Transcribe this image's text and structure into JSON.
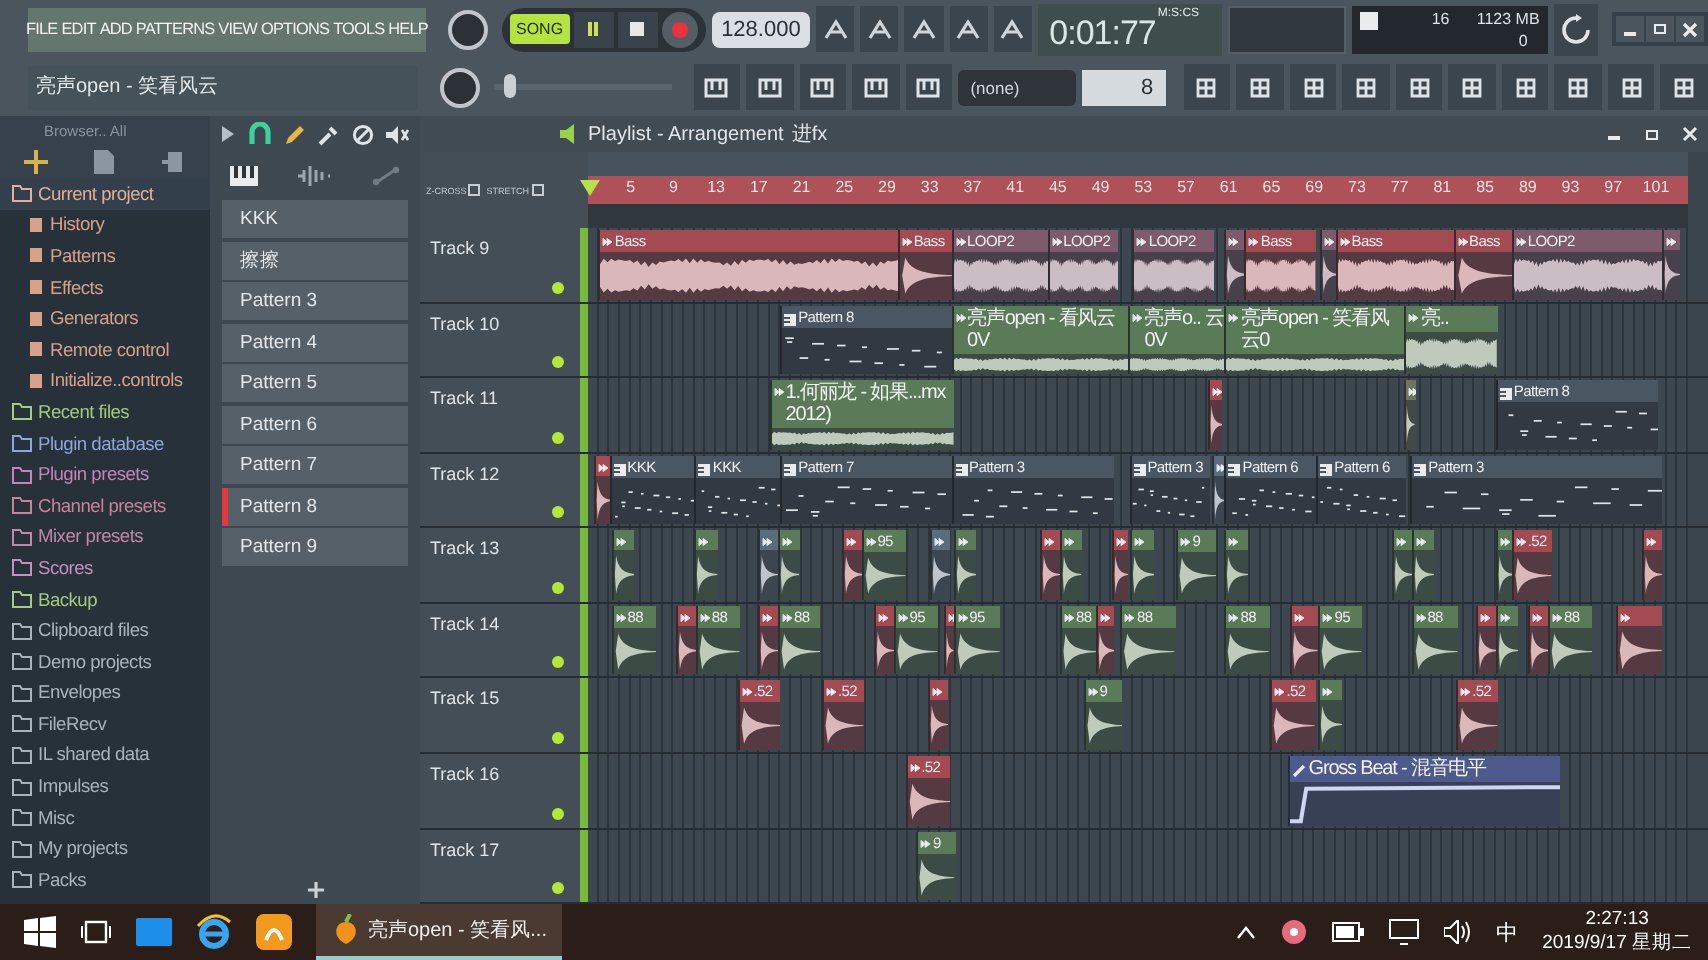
{
  "menu": [
    "FILE",
    "EDIT",
    "ADD",
    "PATTERNS",
    "VIEW",
    "OPTIONS",
    "TOOLS",
    "HELP"
  ],
  "hint_bar": {
    "text": "亮声open - 笑看风云"
  },
  "pitch_slider": {
    "level": 0.05
  },
  "transport": {
    "mode_label": "SONG",
    "song_selected": true,
    "tempo": "128.000",
    "time": "0:01:77",
    "time_unit": "M:S:CS"
  },
  "status": {
    "polyphony": "16",
    "memory": "1123 MB",
    "cpu": "0"
  },
  "toolbar": {
    "preset": "(none)",
    "snap": "8"
  },
  "browser": {
    "title": "Browser.. All",
    "items": [
      {
        "label": "Current project",
        "color": "#e0b09a",
        "selected": true,
        "children": [
          {
            "label": "History",
            "color": "#d9a08a",
            "selected": false
          },
          {
            "label": "Patterns",
            "color": "#d9a08a",
            "selected": false
          },
          {
            "label": "Effects",
            "color": "#d9a08a",
            "selected": false
          },
          {
            "label": "Generators",
            "color": "#d9a08a",
            "selected": false
          },
          {
            "label": "Remote control",
            "color": "#d9a08a",
            "selected": false
          },
          {
            "label": "Initialize..controls",
            "color": "#d9a08a",
            "selected": false
          }
        ]
      },
      {
        "label": "Recent files",
        "color": "#a9c97c",
        "selected": false
      },
      {
        "label": "Plugin database",
        "color": "#8ea6dc",
        "selected": false
      },
      {
        "label": "Plugin presets",
        "color": "#c883b8",
        "selected": false
      },
      {
        "label": "Channel presets",
        "color": "#c8829e",
        "selected": false
      },
      {
        "label": "Mixer presets",
        "color": "#c487ab",
        "selected": false
      },
      {
        "label": "Scores",
        "color": "#c88fbb",
        "selected": false
      },
      {
        "label": "Backup",
        "color": "#a9c97c",
        "selected": false
      },
      {
        "label": "Clipboard files",
        "color": "#a9b3bc",
        "selected": false
      },
      {
        "label": "Demo projects",
        "color": "#a9b3bc",
        "selected": false
      },
      {
        "label": "Envelopes",
        "color": "#a9b3bc",
        "selected": false
      },
      {
        "label": "FileRecv",
        "color": "#a9b3bc",
        "selected": false
      },
      {
        "label": "IL shared data",
        "color": "#a9b3bc",
        "selected": false
      },
      {
        "label": "Impulses",
        "color": "#a9b3bc",
        "selected": false
      },
      {
        "label": "Misc",
        "color": "#a9b3bc",
        "selected": false
      },
      {
        "label": "My projects",
        "color": "#a9b3bc",
        "selected": false
      },
      {
        "label": "Packs",
        "color": "#a9b3bc",
        "selected": false
      }
    ]
  },
  "patterns": [
    {
      "label": "KKK",
      "selected": false
    },
    {
      "label": "擦擦",
      "selected": false
    },
    {
      "label": "Pattern 3",
      "selected": false
    },
    {
      "label": "Pattern 4",
      "selected": false
    },
    {
      "label": "Pattern 5",
      "selected": false
    },
    {
      "label": "Pattern 6",
      "selected": false
    },
    {
      "label": "Pattern 7",
      "selected": false
    },
    {
      "label": "Pattern 8",
      "selected": true
    },
    {
      "label": "Pattern 9",
      "selected": false
    }
  ],
  "playlist": {
    "title": "Playlist - Arrangement",
    "breadcrumb": "进fx",
    "z_cross": {
      "label": "Z-CROSS",
      "checked": false
    },
    "stretch": {
      "label": "STRETCH",
      "checked": false
    },
    "ruler": [
      "5",
      "9",
      "13",
      "17",
      "21",
      "25",
      "29",
      "33",
      "37",
      "41",
      "45",
      "49",
      "53",
      "57",
      "61",
      "65",
      "69",
      "73",
      "77",
      "81",
      "85",
      "89",
      "93",
      "97",
      "101"
    ],
    "tracks": [
      {
        "name": "Track 9",
        "enabled": true,
        "clips": [
          {
            "label": "Bass",
            "kind": "audio",
            "color": "#a34a53"
          },
          {
            "label": "Bass",
            "kind": "audio",
            "color": "#a34a53"
          },
          {
            "label": "LOOP2",
            "kind": "audio",
            "color": "#7e5a6d"
          },
          {
            "label": "LOOP2",
            "kind": "audio",
            "color": "#7e5a6d"
          },
          {
            "label": "LOOP2",
            "kind": "audio",
            "color": "#7e5a6d"
          },
          {
            "kind": "audio",
            "color": "#7e5a6d"
          },
          {
            "label": "Bass",
            "kind": "audio",
            "color": "#a34a53"
          },
          {
            "kind": "audio",
            "color": "#7e5a6d"
          },
          {
            "label": "Bass",
            "kind": "audio",
            "color": "#a34a53"
          },
          {
            "label": "Bass",
            "kind": "audio",
            "color": "#a34a53"
          },
          {
            "label": "LOOP2",
            "kind": "audio",
            "color": "#7e5a6d"
          },
          {
            "kind": "audio",
            "color": "#7e5a6d"
          }
        ]
      },
      {
        "name": "Track 10",
        "enabled": true,
        "clips": [
          {
            "label": "Pattern 8",
            "kind": "pattern",
            "color": "#4b5663"
          },
          {
            "label": "亮声open - 看风云0V",
            "kind": "audio",
            "color": "#5b7a58"
          },
          {
            "label": "亮声o.. 云0V",
            "kind": "audio",
            "color": "#5b7a58"
          },
          {
            "label": "亮声open - 笑看风云0",
            "kind": "audio",
            "color": "#5b7a58"
          },
          {
            "label": "亮..",
            "kind": "audio",
            "color": "#5b7a58"
          }
        ]
      },
      {
        "name": "Track 11",
        "enabled": true,
        "clips": [
          {
            "label": "1.何丽龙 - 如果...mx 2012)",
            "kind": "audio",
            "color": "#5b7a58"
          },
          {
            "kind": "audio",
            "color": "#a34a53"
          },
          {
            "kind": "audio",
            "color": "#6d7560"
          },
          {
            "label": "Pattern 8",
            "kind": "pattern",
            "color": "#4b5663"
          }
        ]
      },
      {
        "name": "Track 12",
        "enabled": true,
        "clips": [
          {
            "kind": "audio",
            "color": "#a34a53"
          },
          {
            "label": "KKK",
            "kind": "pattern",
            "color": "#4b5663"
          },
          {
            "label": "KKK",
            "kind": "pattern",
            "color": "#4b5663"
          },
          {
            "label": "Pattern 7",
            "kind": "pattern",
            "color": "#4b5663"
          },
          {
            "label": "Pattern 3",
            "kind": "pattern",
            "color": "#4b5663"
          },
          {
            "label": "Pattern 3",
            "kind": "pattern",
            "color": "#4b5663"
          },
          {
            "kind": "audio",
            "color": "#5b6c7c"
          },
          {
            "label": "Pattern 6",
            "kind": "pattern",
            "color": "#4b5663"
          },
          {
            "label": "Pattern 6",
            "kind": "pattern",
            "color": "#4b5663"
          },
          {
            "label": "Pattern 3",
            "kind": "pattern",
            "color": "#4b5663"
          }
        ]
      },
      {
        "name": "Track 13",
        "enabled": true,
        "clips": [
          {
            "kind": "audio",
            "color": "#5b7a58"
          },
          {
            "kind": "audio",
            "color": "#5b7a58"
          },
          {
            "kind": "audio",
            "color": "#5b6c7c"
          },
          {
            "kind": "audio",
            "color": "#5b7a58"
          },
          {
            "kind": "audio",
            "color": "#a34a53"
          },
          {
            "label": "95",
            "kind": "audio",
            "color": "#5b7a58"
          },
          {
            "kind": "audio",
            "color": "#5b6c7c"
          },
          {
            "kind": "audio",
            "color": "#5b7a58"
          },
          {
            "kind": "audio",
            "color": "#a34a53"
          },
          {
            "kind": "audio",
            "color": "#5b7a58"
          },
          {
            "kind": "audio",
            "color": "#a34a53"
          },
          {
            "kind": "audio",
            "color": "#5b7a58"
          },
          {
            "label": "9",
            "kind": "audio",
            "color": "#5b7a58"
          },
          {
            "kind": "audio",
            "color": "#5b7a58"
          },
          {
            "kind": "audio",
            "color": "#5b7a58"
          },
          {
            "kind": "audio",
            "color": "#5b7a58"
          },
          {
            "kind": "audio",
            "color": "#5b7a58"
          },
          {
            "label": ".52",
            "kind": "audio",
            "color": "#a34a53"
          },
          {
            "kind": "audio",
            "color": "#a34a53"
          }
        ]
      },
      {
        "name": "Track 14",
        "enabled": true,
        "clips": [
          {
            "label": "88",
            "kind": "audio",
            "color": "#5b7a58"
          },
          {
            "kind": "audio",
            "color": "#a34a53"
          },
          {
            "label": "88",
            "kind": "audio",
            "color": "#5b7a58"
          },
          {
            "kind": "audio",
            "color": "#a34a53"
          },
          {
            "label": "88",
            "kind": "audio",
            "color": "#5b7a58"
          },
          {
            "kind": "audio",
            "color": "#a34a53"
          },
          {
            "label": "95",
            "kind": "audio",
            "color": "#5b7a58"
          },
          {
            "kind": "audio",
            "color": "#a34a53"
          },
          {
            "label": "95",
            "kind": "audio",
            "color": "#5b7a58"
          },
          {
            "label": "88",
            "kind": "audio",
            "color": "#5b7a58"
          },
          {
            "kind": "audio",
            "color": "#a34a53"
          },
          {
            "label": "88",
            "kind": "audio",
            "color": "#5b7a58"
          },
          {
            "label": "88",
            "kind": "audio",
            "color": "#5b7a58"
          },
          {
            "kind": "audio",
            "color": "#a34a53"
          },
          {
            "label": "95",
            "kind": "audio",
            "color": "#5b7a58"
          },
          {
            "label": "88",
            "kind": "audio",
            "color": "#5b7a58"
          },
          {
            "kind": "audio",
            "color": "#a34a53"
          },
          {
            "kind": "audio",
            "color": "#5b7a58"
          },
          {
            "kind": "audio",
            "color": "#a34a53"
          },
          {
            "label": "88",
            "kind": "audio",
            "color": "#5b7a58"
          },
          {
            "kind": "audio",
            "color": "#a34a53"
          }
        ]
      },
      {
        "name": "Track 15",
        "enabled": true,
        "clips": [
          {
            "label": ".52",
            "kind": "audio",
            "color": "#a34a53"
          },
          {
            "label": ".52",
            "kind": "audio",
            "color": "#a34a53"
          },
          {
            "kind": "audio",
            "color": "#a34a53"
          },
          {
            "label": "9",
            "kind": "audio",
            "color": "#5b7a58"
          },
          {
            "label": ".52",
            "kind": "audio",
            "color": "#a34a53"
          },
          {
            "kind": "audio",
            "color": "#5b7a58"
          },
          {
            "label": ".52",
            "kind": "audio",
            "color": "#a34a53"
          }
        ]
      },
      {
        "name": "Track 16",
        "enabled": true,
        "clips": [
          {
            "label": ".52",
            "kind": "audio",
            "color": "#a34a53"
          },
          {
            "label": "Gross Beat - 混音电平",
            "kind": "automation",
            "color": "#4e5a8c"
          }
        ]
      },
      {
        "name": "Track 17",
        "enabled": true,
        "clips": [
          {
            "label": "9",
            "kind": "audio",
            "color": "#5b7a58"
          }
        ]
      }
    ]
  },
  "taskbar": {
    "app": "亮声open - 笑看风...",
    "ime": "中",
    "time": "2:27:13",
    "date": "2019/9/17 星期二"
  }
}
